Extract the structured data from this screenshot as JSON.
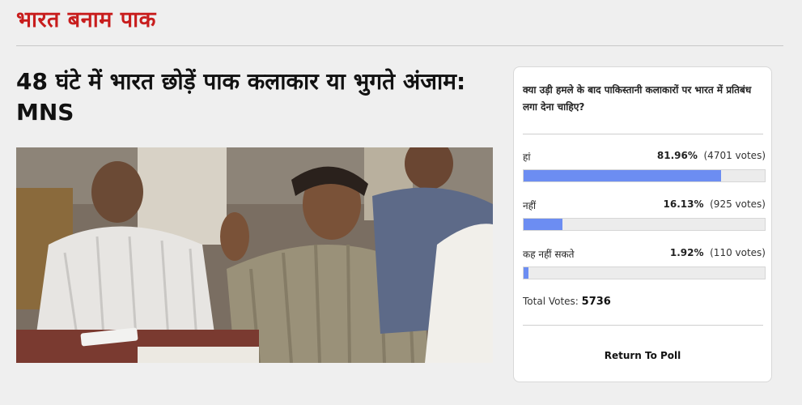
{
  "section": {
    "title": "भारत बनाम पाक"
  },
  "article": {
    "headline": "48 घंटे में भारत छोड़ें पाक कलाकार या भुगते अंजाम: MNS",
    "photo_alt": "press-conference-photo"
  },
  "poll": {
    "question": "क्या उड़ी हमले के बाद पाकिस्तानी कलाकारों पर भारत में प्रतिबंध लगा देना चाहिए?",
    "options": [
      {
        "label": "हां",
        "percent_text": "81.96%",
        "votes_text": "(4701 votes)",
        "fraction": 0.8196
      },
      {
        "label": "नहीं",
        "percent_text": "16.13%",
        "votes_text": "(925 votes)",
        "fraction": 0.1613
      },
      {
        "label": "कह नहीं सकते",
        "percent_text": "1.92%",
        "votes_text": "(110 votes)",
        "fraction": 0.0192
      }
    ],
    "total_label": "Total Votes:",
    "total_value": "5736",
    "return_label": "Return To Poll",
    "bar_color": "#6c8df2"
  }
}
